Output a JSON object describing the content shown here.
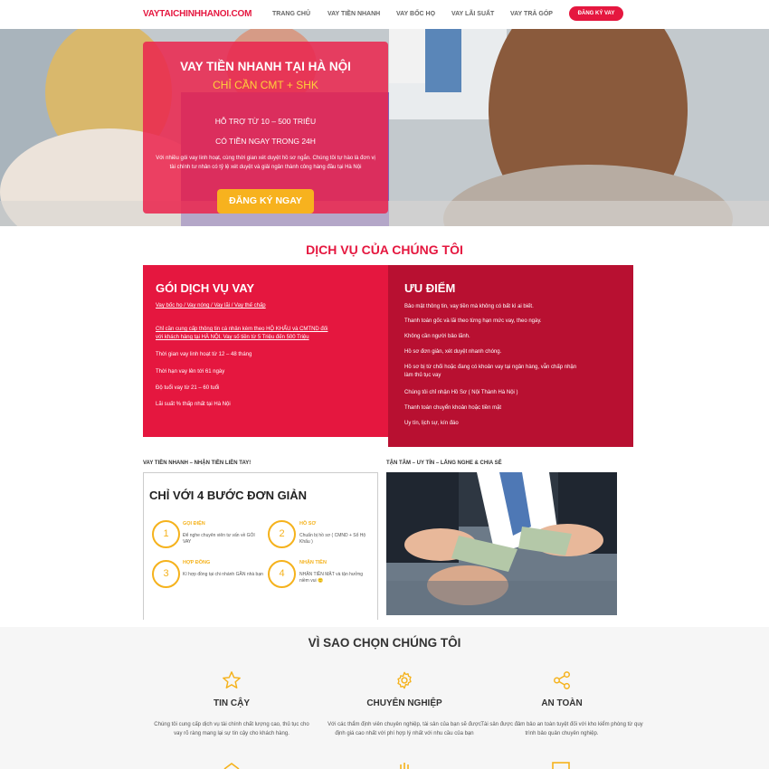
{
  "header": {
    "logo": "VAYTAICHINHHANOI.COM",
    "nav": [
      "TRANG CHỦ",
      "VAY TIỀN NHANH",
      "VAY BỐC HỌ",
      "VAY LÃI SUẤT",
      "VAY TRẢ GÓP"
    ],
    "cta": "ĐĂNG KÝ VAY"
  },
  "hero": {
    "title": "VAY TIỀN NHANH TẠI HÀ NỘI",
    "subtitle": "CHỈ CẦN CMT + SHK",
    "line1": "HỖ TRỢ TỪ 10 – 500 TRIỆU",
    "line2": "CÓ TIỀN NGAY TRONG 24H",
    "description": "Với nhiều gói vay linh hoạt, cùng thời gian xét duyệt hồ sơ ngắn. Chúng tôi tự hào là đơn vị tài chính tư nhân có tỷ lệ xét duyệt và giải ngân thành công hàng đầu tại Hà Nội",
    "button": "ĐĂNG KÝ NGAY"
  },
  "services": {
    "title": "DỊCH VỤ CỦA CHÚNG TÔI",
    "left": {
      "heading": "GÓI DỊCH VỤ VAY",
      "lines": [
        "Vay bốc họ / Vay nóng / Vay lãi / Vay thế chấp",
        "Chỉ cần cung cấp thông tin cá nhân kèm theo HỘ KHẨU và CMTND đối",
        "với khách hàng tại HÀ NỘI. Vay số tiền từ 5 Triệu đến 500 Triệu",
        "Thời gian vay linh hoạt từ 12 – 48 tháng",
        "Thời hạn vay lên tới 61 ngày",
        "Độ tuổi vay từ 21 – 60 tuổi",
        "Lãi suất % thấp nhất tại Hà Nội"
      ]
    },
    "right": {
      "heading": "ƯU ĐIỂM",
      "lines": [
        "Bảo mật thông tin, vay tiền mà không có bất kì ai biết.",
        "Thanh toán gốc và lãi theo từng hạn mức vay, theo ngày.",
        "Không cần người bảo lãnh.",
        "Hồ sơ đơn giản, xét duyệt nhanh chóng.",
        "Hồ sơ bị từ chối hoặc đang có khoản vay tại ngân hàng, vẫn chấp nhận",
        "làm thủ tục vay",
        "Chúng tôi chỉ nhận Hồ Sơ ( Nội Thành Hà Nội )",
        "Thanh toán chuyển khoản hoặc tiền mặt",
        "Uy tín, lịch sự, kín đáo"
      ]
    }
  },
  "steps": {
    "left_caption": "VAY TIỀN NHANH – NHẬN TIỀN LIỀN TAY!",
    "right_caption": "TẬN TÂM – UY TÍN – LẮNG NGHE & CHIA SẺ",
    "heading": "CHỈ VỚI 4 BƯỚC ĐƠN GIẢN",
    "items": [
      {
        "num": "1",
        "title": "GỌI ĐIỆN",
        "text": "Để nghe chuyên viên tư vấn về GÓI VAY"
      },
      {
        "num": "2",
        "title": "HỒ SƠ",
        "text": "Chuẩn bị hồ sơ ( CMND + Sổ Hộ Khẩu )"
      },
      {
        "num": "3",
        "title": "HỢP ĐỒNG",
        "text": "Kí hợp đồng tại chi nhánh GẦN nhà bạn"
      },
      {
        "num": "4",
        "title": "NHẬN TIỀN",
        "text": "NHẬN TIỀN MẶT và tận hưởng niềm vui 🙂"
      }
    ]
  },
  "why": {
    "title": "VÌ SAO CHỌN CHÚNG TÔI",
    "items": [
      {
        "icon": "star-icon",
        "name": "TIN CẬY",
        "text": "Chúng tôi cung cấp dịch vụ tài chính chất lượng cao, thủ tục cho vay rõ ràng mang lại sự tin cậy cho khách hàng."
      },
      {
        "icon": "gear-icon",
        "name": "CHUYÊN NGHIỆP",
        "text": "Với các thẩm định viên chuyên nghiệp, tài sản của bạn sẽ được định giá cao nhất với phí hợp lý nhất với nhu cầu của bạn"
      },
      {
        "icon": "share-icon",
        "name": "AN TOÀN",
        "text": "Tài sản được đảm bảo an toàn tuyệt đối với kho kiểm phòng từ quy trình bảo quản chuyên nghiệp."
      }
    ]
  },
  "colors": {
    "brand": "#e5173f",
    "accent": "#f5b21c",
    "dark_red": "#b81031"
  }
}
